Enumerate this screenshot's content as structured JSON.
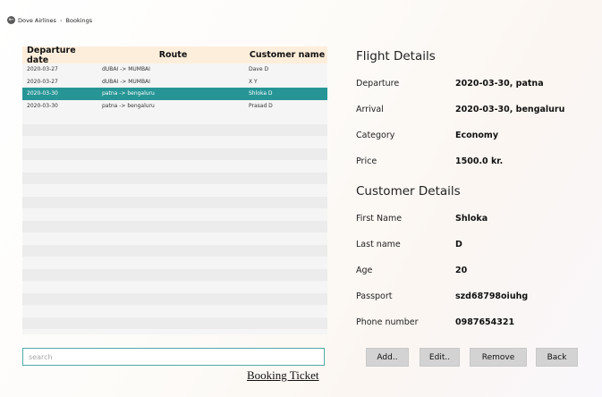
{
  "breadcrumb": {
    "icon": "back-arrow-icon",
    "app": "Dove Airlines",
    "separator": "›",
    "page": "Bookings"
  },
  "table": {
    "columns": [
      "Departure date",
      "Route",
      "Customer name"
    ],
    "rows": [
      {
        "date": "2020-03-27",
        "route": "dUBAI -> MUMBAI",
        "customer": "Dave D"
      },
      {
        "date": "2020-03-27",
        "route": "dUBAI -> MUMBAI",
        "customer": "X Y"
      },
      {
        "date": "2020-03-30",
        "route": "patna -> bengaluru",
        "customer": "Shloka D"
      },
      {
        "date": "2020-03-30",
        "route": "patna -> bengaluru",
        "customer": "Prasad D"
      }
    ],
    "selected_index": 2,
    "selection_color": "#279596",
    "header_color": "#fdeedb"
  },
  "search": {
    "placeholder": "search",
    "value": ""
  },
  "flight_details": {
    "title": "Flight Details",
    "departure_label": "Departure",
    "departure_value": "2020-03-30, patna",
    "arrival_label": "Arrival",
    "arrival_value": "2020-03-30, bengaluru",
    "category_label": "Category",
    "category_value": "Economy",
    "price_label": "Price",
    "price_value": "1500.0 kr."
  },
  "customer_details": {
    "title": "Customer Details",
    "first_name_label": "First Name",
    "first_name_value": "Shloka",
    "last_name_label": "Last name",
    "last_name_value": "D",
    "age_label": "Age",
    "age_value": "20",
    "passport_label": "Passport",
    "passport_value": "szd68798oiuhg",
    "phone_label": "Phone number",
    "phone_value": "0987654321"
  },
  "buttons": {
    "add": "Add..",
    "edit": "Edit..",
    "remove": "Remove",
    "back": "Back"
  },
  "footer": {
    "link": "Booking Ticket"
  }
}
